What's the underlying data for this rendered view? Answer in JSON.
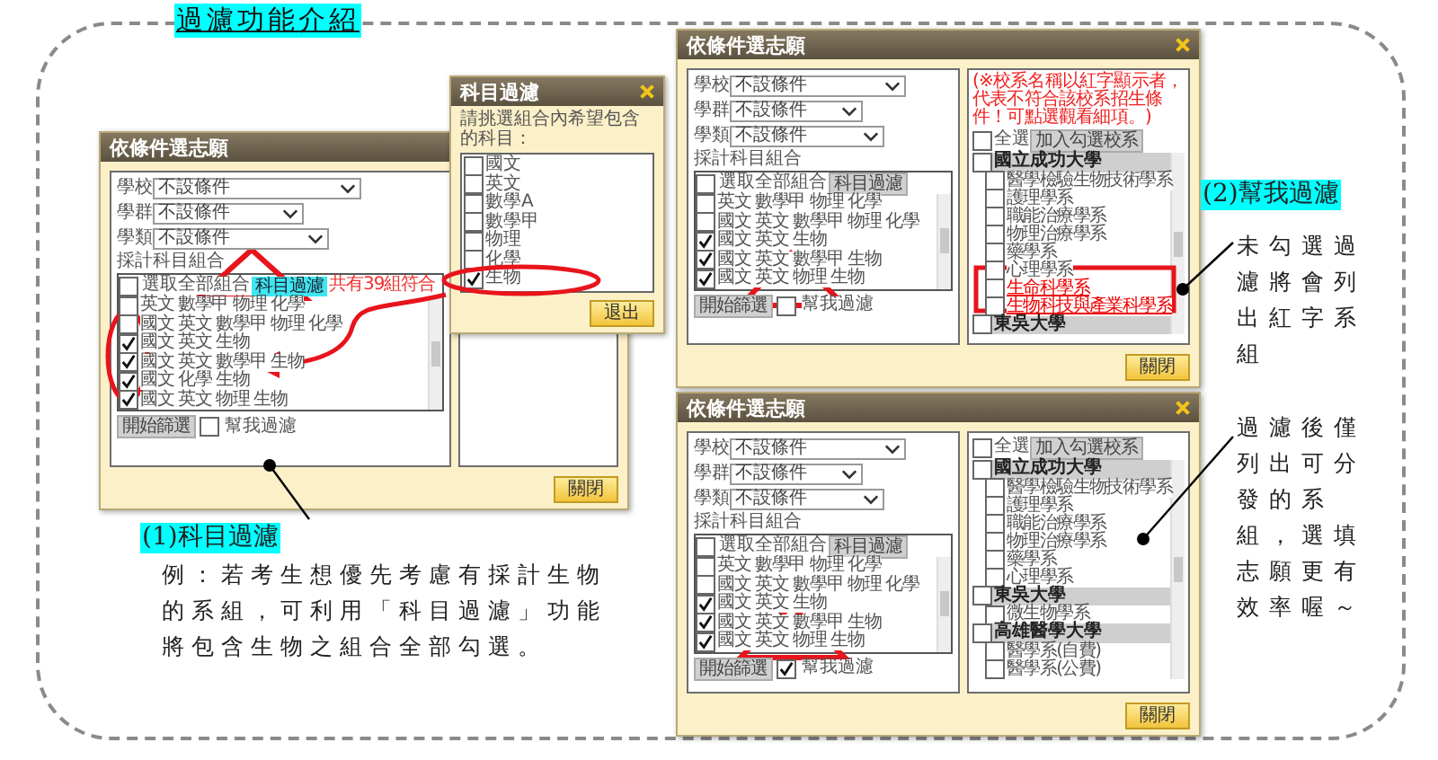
{
  "title": "過濾功能介紹",
  "dialogs": [
    {
      "title": "依條件選志願",
      "fields": [
        {
          "label": "學校",
          "value": "不設條件"
        },
        {
          "label": "學群",
          "value": "不設條件"
        },
        {
          "label": "學類",
          "value": "不設條件"
        }
      ],
      "combo_label": "採計科目組合",
      "select_all": {
        "label": "選取全部組合",
        "checked": false
      },
      "filter_button": {
        "label": "科目過濾",
        "highlighted": true
      },
      "match_count": "共有39組符合",
      "combinations": [
        {
          "label": "英文 數學甲 物理 化學",
          "checked": false
        },
        {
          "label": "國文 英文 數學甲 物理 化學",
          "checked": false
        },
        {
          "label": "國文 英文 生物",
          "checked": true
        },
        {
          "label": "國文 英文 數學甲 生物",
          "checked": true
        },
        {
          "label": "國文 化學 生物",
          "checked": true
        },
        {
          "label": "國文 英文 物理 生物",
          "checked": true
        }
      ],
      "start_button": "開始篩選",
      "help_filter": {
        "label": "幫我過濾",
        "checked": false
      },
      "close_button": "關閉"
    },
    {
      "title": "依條件選志願",
      "fields": [
        {
          "label": "學校",
          "value": "不設條件"
        },
        {
          "label": "學群",
          "value": "不設條件"
        },
        {
          "label": "學類",
          "value": "不設條件"
        }
      ],
      "combo_label": "採計科目組合",
      "select_all": {
        "label": "選取全部組合",
        "checked": false
      },
      "filter_button": {
        "label": "科目過濾",
        "highlighted": false
      },
      "combinations": [
        {
          "label": "英文 數學甲 物理 化學",
          "checked": false
        },
        {
          "label": "國文 英文 數學甲 物理 化學",
          "checked": false
        },
        {
          "label": "國文 英文 生物",
          "checked": true
        },
        {
          "label": "國文 英文 數學甲 生物",
          "checked": true
        },
        {
          "label": "國文 英文 物理 生物",
          "checked": true
        }
      ],
      "start_button": "開始篩選",
      "help_filter": {
        "label": "幫我過濾",
        "checked": false
      },
      "results": {
        "note": "(※校系名稱以紅字顯示者，代表不符合該校系招生條件！可點選觀看細項。)",
        "select_all": {
          "label": "全選",
          "checked": false
        },
        "add_button": "加入勾選校系",
        "groups": [
          {
            "name": "國立成功大學",
            "checked": false,
            "departments": [
              {
                "name": "醫學檢驗生物技術學系",
                "checked": false,
                "eligible": true
              },
              {
                "name": "護理學系",
                "checked": false,
                "eligible": true
              },
              {
                "name": "職能治療學系",
                "checked": false,
                "eligible": true
              },
              {
                "name": "物理治療學系",
                "checked": false,
                "eligible": true
              },
              {
                "name": "藥學系",
                "checked": false,
                "eligible": true
              },
              {
                "name": "心理學系",
                "checked": false,
                "eligible": true
              },
              {
                "name": "生命科學系",
                "checked": false,
                "eligible": false
              },
              {
                "name": "生物科技與產業科學系",
                "checked": false,
                "eligible": false
              }
            ]
          },
          {
            "name": "東吳大學",
            "checked": false
          }
        ]
      },
      "close_button": "關閉"
    },
    {
      "title": "依條件選志願",
      "fields": [
        {
          "label": "學校",
          "value": "不設條件"
        },
        {
          "label": "學群",
          "value": "不設條件"
        },
        {
          "label": "學類",
          "value": "不設條件"
        }
      ],
      "combo_label": "採計科目組合",
      "select_all": {
        "label": "選取全部組合",
        "checked": false
      },
      "filter_button": {
        "label": "科目過濾",
        "highlighted": false
      },
      "combinations": [
        {
          "label": "英文 數學甲 物理 化學",
          "checked": false
        },
        {
          "label": "國文 英文 數學甲 物理 化學",
          "checked": false
        },
        {
          "label": "國文 英文 生物",
          "checked": true
        },
        {
          "label": "國文 英文 數學甲 生物",
          "checked": true
        },
        {
          "label": "國文 英文 物理 生物",
          "checked": true
        }
      ],
      "start_button": "開始篩選",
      "help_filter": {
        "label": "幫我過濾",
        "checked": true
      },
      "results": {
        "select_all": {
          "label": "全選",
          "checked": false
        },
        "add_button": "加入勾選校系",
        "groups": [
          {
            "name": "國立成功大學",
            "checked": false,
            "departments": [
              {
                "name": "醫學檢驗生物技術學系",
                "checked": false,
                "eligible": true
              },
              {
                "name": "護理學系",
                "checked": false,
                "eligible": true
              },
              {
                "name": "職能治療學系",
                "checked": false,
                "eligible": true
              },
              {
                "name": "物理治療學系",
                "checked": false,
                "eligible": true
              },
              {
                "name": "藥學系",
                "checked": false,
                "eligible": true
              },
              {
                "name": "心理學系",
                "checked": false,
                "eligible": true
              }
            ]
          },
          {
            "name": "東吳大學",
            "checked": false,
            "departments": [
              {
                "name": "微生物學系",
                "checked": false,
                "eligible": true
              }
            ]
          },
          {
            "name": "高雄醫學大學",
            "checked": false,
            "departments": [
              {
                "name": "醫學系(自費)",
                "checked": false,
                "eligible": true
              },
              {
                "name": "醫學系(公費)",
                "checked": false,
                "eligible": true
              }
            ]
          }
        ]
      },
      "close_button": "關閉"
    }
  ],
  "subject_filter": {
    "title": "科目過濾",
    "prompt": "請挑選組合內希望包含的科目：",
    "subjects": [
      {
        "label": "國文",
        "checked": false
      },
      {
        "label": "英文",
        "checked": false
      },
      {
        "label": "數學A",
        "checked": false
      },
      {
        "label": "數學甲",
        "checked": false
      },
      {
        "label": "物理",
        "checked": false
      },
      {
        "label": "化學",
        "checked": false
      },
      {
        "label": "生物",
        "checked": true
      }
    ],
    "exit_button": "退出"
  },
  "captions": [
    {
      "heading": "(1)科目過濾",
      "body": "例：若考生想優先考慮有採計生物的系組，可利用「科目過濾」功能將包含生物之組合全部勾選。"
    },
    {
      "heading": "(2)幫我過濾",
      "body": "未勾選過濾將會列出紅字系組"
    },
    {
      "body": "過濾後僅列出可分發的系組，選填志願更有效率喔～"
    }
  ]
}
